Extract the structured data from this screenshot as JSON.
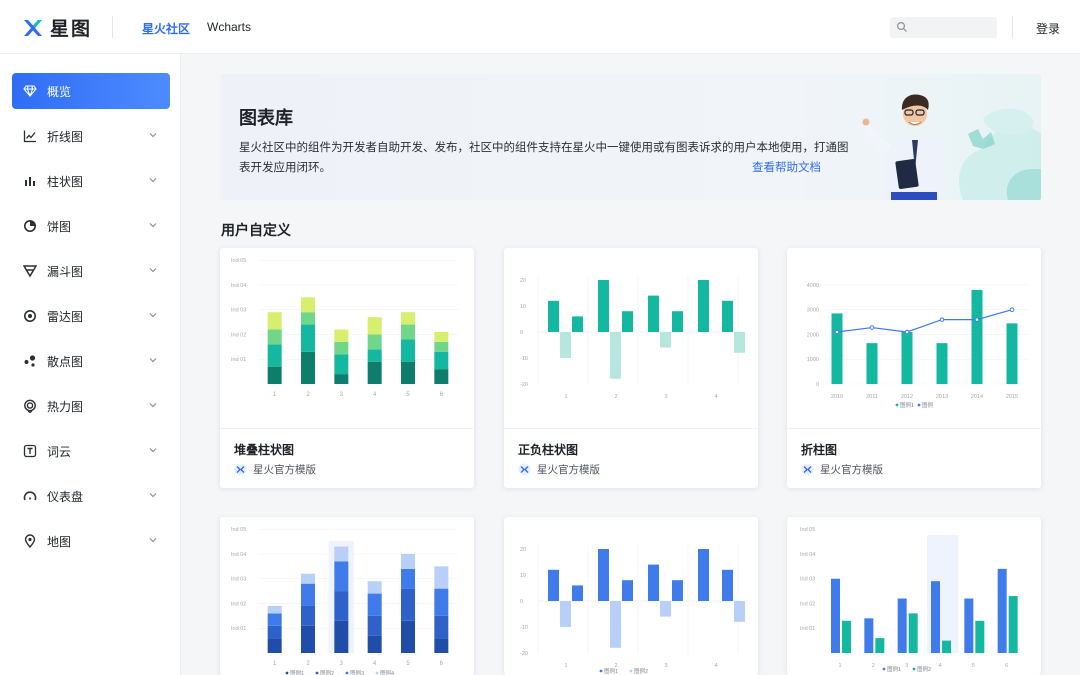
{
  "header": {
    "logo_text": "星图",
    "nav": [
      "星火社区",
      "Wcharts"
    ],
    "search_placeholder": "",
    "login_label": "登录"
  },
  "sidebar": {
    "items": [
      {
        "label": "概览",
        "icon": "gem-icon",
        "active": true
      },
      {
        "label": "折线图",
        "icon": "line-chart-icon"
      },
      {
        "label": "柱状图",
        "icon": "bar-chart-icon"
      },
      {
        "label": "饼图",
        "icon": "pie-chart-icon"
      },
      {
        "label": "漏斗图",
        "icon": "funnel-icon"
      },
      {
        "label": "雷达图",
        "icon": "radar-icon"
      },
      {
        "label": "散点图",
        "icon": "scatter-icon"
      },
      {
        "label": "热力图",
        "icon": "heatmap-icon"
      },
      {
        "label": "词云",
        "icon": "wordcloud-icon"
      },
      {
        "label": "仪表盘",
        "icon": "gauge-icon"
      },
      {
        "label": "地图",
        "icon": "map-pin-icon"
      }
    ]
  },
  "banner": {
    "title": "图表库",
    "description": "星火社区中的组件为开发者自助开发、发布，社区中的组件支持在星火中一键使用或有图表诉求的用户本地使用，打通图表开发应用闭环。",
    "link_label": "查看帮助文档"
  },
  "section": {
    "title": "用户自定义"
  },
  "cards": [
    {
      "name": "堆叠柱状图",
      "author": "星火官方模版"
    },
    {
      "name": "正负柱状图",
      "author": "星火官方模版"
    },
    {
      "name": "折柱图",
      "author": "星火官方模版"
    },
    {
      "name": "",
      "author": ""
    },
    {
      "name": "",
      "author": ""
    },
    {
      "name": "",
      "author": ""
    }
  ],
  "colors": {
    "accent": "#2f6df6",
    "teal_dark": "#0f7d6b",
    "teal": "#14b8a0",
    "green": "#6fd68a",
    "lime": "#d7ef6e",
    "blue": "#3f7bea",
    "blue_dark": "#1f4da8",
    "blue_light": "#b8d0f7"
  },
  "chart_data": [
    {
      "type": "bar",
      "stacked": true,
      "categories": [
        "1",
        "2",
        "3",
        "4",
        "5",
        "6"
      ],
      "y_ticks": [
        "Ind 01",
        "Ind 02",
        "Ind 03",
        "Ind 04",
        "Ind 05"
      ],
      "series": [
        {
          "values": [
            0.7,
            1.3,
            0.4,
            0.9,
            0.9,
            0.6
          ]
        },
        {
          "values": [
            0.9,
            1.1,
            0.8,
            0.5,
            0.9,
            0.7
          ]
        },
        {
          "values": [
            0.6,
            0.5,
            0.5,
            0.6,
            0.6,
            0.4
          ]
        },
        {
          "values": [
            0.7,
            0.6,
            0.5,
            0.7,
            0.5,
            0.4
          ]
        }
      ],
      "ylim": [
        0,
        4.2
      ]
    },
    {
      "type": "bar",
      "categories": [
        "1",
        "2",
        "3",
        "4"
      ],
      "y_ticks": [
        "20",
        "10",
        "0",
        "-10",
        "-20"
      ],
      "series": [
        {
          "values": [
            12,
            20,
            14,
            20
          ]
        },
        {
          "values": [
            6,
            8,
            8,
            12
          ]
        },
        {
          "values": [
            -10,
            -18,
            -6,
            0
          ]
        },
        {
          "values": [
            0,
            0,
            0,
            -8
          ]
        }
      ],
      "ylim": [
        -20,
        20
      ]
    },
    {
      "type": "bar+line",
      "categories": [
        "2010",
        "2011",
        "2012",
        "2013",
        "2014",
        "2015"
      ],
      "y_ticks": [
        "0",
        "1000",
        "2000",
        "3000",
        "4000"
      ],
      "series": [
        {
          "name": "图例1",
          "type": "bar",
          "values": [
            2850,
            1650,
            2100,
            1650,
            3800,
            2450
          ]
        },
        {
          "name": "图例",
          "type": "line",
          "values": [
            2100,
            2280,
            2100,
            2600,
            2600,
            3000
          ]
        }
      ],
      "ylim": [
        0,
        4200
      ]
    },
    {
      "type": "bar",
      "stacked": true,
      "categories": [
        "1",
        "2",
        "3",
        "4",
        "5",
        "6"
      ],
      "y_ticks": [
        "Ind 01",
        "Ind 02",
        "Ind 03",
        "Ind 04",
        "Ind 05"
      ],
      "series": [
        {
          "name": "图例1",
          "values": [
            0.6,
            1.1,
            1.3,
            0.7,
            1.3,
            0.6
          ]
        },
        {
          "name": "图例2",
          "values": [
            0.5,
            0.8,
            1.2,
            0.8,
            1.3,
            0.9
          ]
        },
        {
          "name": "图例3",
          "values": [
            0.5,
            0.9,
            1.2,
            0.9,
            0.8,
            1.1
          ]
        },
        {
          "name": "图例4",
          "values": [
            0.3,
            0.4,
            0.6,
            0.5,
            0.6,
            0.9
          ]
        }
      ],
      "ylim": [
        0,
        4.2
      ]
    },
    {
      "type": "bar",
      "categories": [
        "1",
        "2",
        "3",
        "4"
      ],
      "y_ticks": [
        "20",
        "10",
        "0",
        "-10",
        "-20"
      ],
      "series": [
        {
          "name": "图例1",
          "values": [
            12,
            20,
            14,
            20
          ]
        },
        {
          "values": [
            6,
            8,
            8,
            12
          ]
        },
        {
          "name": "图例2",
          "values": [
            -10,
            -18,
            -6,
            0
          ]
        },
        {
          "values": [
            0,
            0,
            0,
            -8
          ]
        }
      ],
      "ylim": [
        -20,
        20
      ]
    },
    {
      "type": "bar",
      "categories": [
        "1",
        "2",
        "3",
        "4",
        "5",
        "6"
      ],
      "y_ticks": [
        "Ind 01",
        "Ind 02",
        "Ind 03",
        "Ind 04",
        "Ind 05"
      ],
      "series": [
        {
          "name": "图例1",
          "values": [
            3.0,
            1.4,
            2.2,
            2.9,
            2.2,
            3.4
          ]
        },
        {
          "name": "图例2",
          "values": [
            1.3,
            0.6,
            1.6,
            0.5,
            1.3,
            2.3
          ]
        }
      ],
      "ylim": [
        0,
        4.2
      ]
    }
  ]
}
